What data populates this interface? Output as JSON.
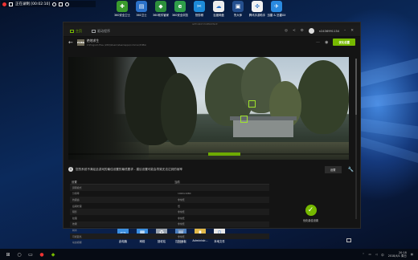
{
  "recorder": {
    "status": "正在录制 [00:02:10]"
  },
  "desktop_icons": [
    {
      "label": "360安全卫士",
      "icon": "360-guard-icon",
      "color": "#3a9b2c",
      "glyph": "✚"
    },
    {
      "label": "360卫士",
      "icon": "folder-icon",
      "color": "#2b71c9",
      "glyph": "▤"
    },
    {
      "label": "360软件管家",
      "icon": "app-store-icon",
      "color": "#2d8f3c",
      "glyph": "◆"
    },
    {
      "label": "360安全浏览",
      "icon": "browser-icon",
      "color": "#2f9e4a",
      "glyph": "e"
    },
    {
      "label": "快剪辑",
      "icon": "video-editor-icon",
      "color": "#1d8ad8",
      "glyph": "✂"
    },
    {
      "label": "百度网盘",
      "icon": "cloud-disk-icon",
      "color": "#eeeeee",
      "glyph": "☁"
    },
    {
      "label": "鲁大师",
      "icon": "benchmark-icon",
      "color": "#25508f",
      "glyph": "▣"
    },
    {
      "label": "腾讯手游助手",
      "icon": "gamepad-icon",
      "color": "#f2f2f2",
      "glyph": "✜"
    },
    {
      "label": "迅雷 & 迅雷XX",
      "icon": "thunder-icon",
      "color": "#2a8ae0",
      "glyph": "✈"
    }
  ],
  "bottom_icons": [
    {
      "label": "此电脑",
      "icon": "computer-icon",
      "color": "#3b8fe0",
      "glyph": "▭"
    },
    {
      "label": "网络",
      "icon": "network-icon",
      "color": "#3b8fe0",
      "glyph": "▦"
    },
    {
      "label": "回收站",
      "icon": "recycle-bin-icon",
      "color": "#9aa4b0",
      "glyph": "♻"
    },
    {
      "label": "控制面板",
      "icon": "control-panel-icon",
      "color": "#4b7fc0",
      "glyph": "▥"
    },
    {
      "label": "Administr...",
      "icon": "user-folder-icon",
      "color": "#e0b84a",
      "glyph": "▮"
    },
    {
      "label": "本地文件",
      "icon": "local-file-icon",
      "color": "#e8e8e8",
      "glyph": "▯"
    }
  ],
  "app": {
    "window_title": "GEFORCE EXPERIENCE",
    "tabs": [
      {
        "label": "主页"
      },
      {
        "label": "驱动程序"
      }
    ],
    "user": "n2436991134",
    "game": {
      "name": "绝地求生",
      "path": "C:\\Program Files (x86)\\Steam\\steamapps\\common\\PUBG\\",
      "optimize_label": "优化设置"
    },
    "notice": {
      "text": "您的系统不满足此游戏的最佳设置的最低要求 - 建议设置可能会导致无法达到的帧率",
      "button_label": "设置"
    },
    "table": {
      "headers": [
        "设置",
        "当前"
      ],
      "rows": [
        [
          "屏幕模式",
          ""
        ],
        [
          "分辨率",
          "1920x1080"
        ],
        [
          "抗锯齿",
          "非常低"
        ],
        [
          "后期处理",
          "低"
        ],
        [
          "阴影",
          "非常低"
        ],
        [
          "纹理",
          "非常低"
        ],
        [
          "效果",
          "非常低"
        ],
        [
          "树木",
          "非常低"
        ],
        [
          "可视距离",
          "非常低"
        ],
        [
          "动态模糊",
          "关闭"
        ]
      ]
    },
    "status": {
      "text": "优化最佳设置"
    }
  },
  "taskbar": {
    "time": "20:18",
    "date": "2018/4/1 周日",
    "lang": "中"
  }
}
